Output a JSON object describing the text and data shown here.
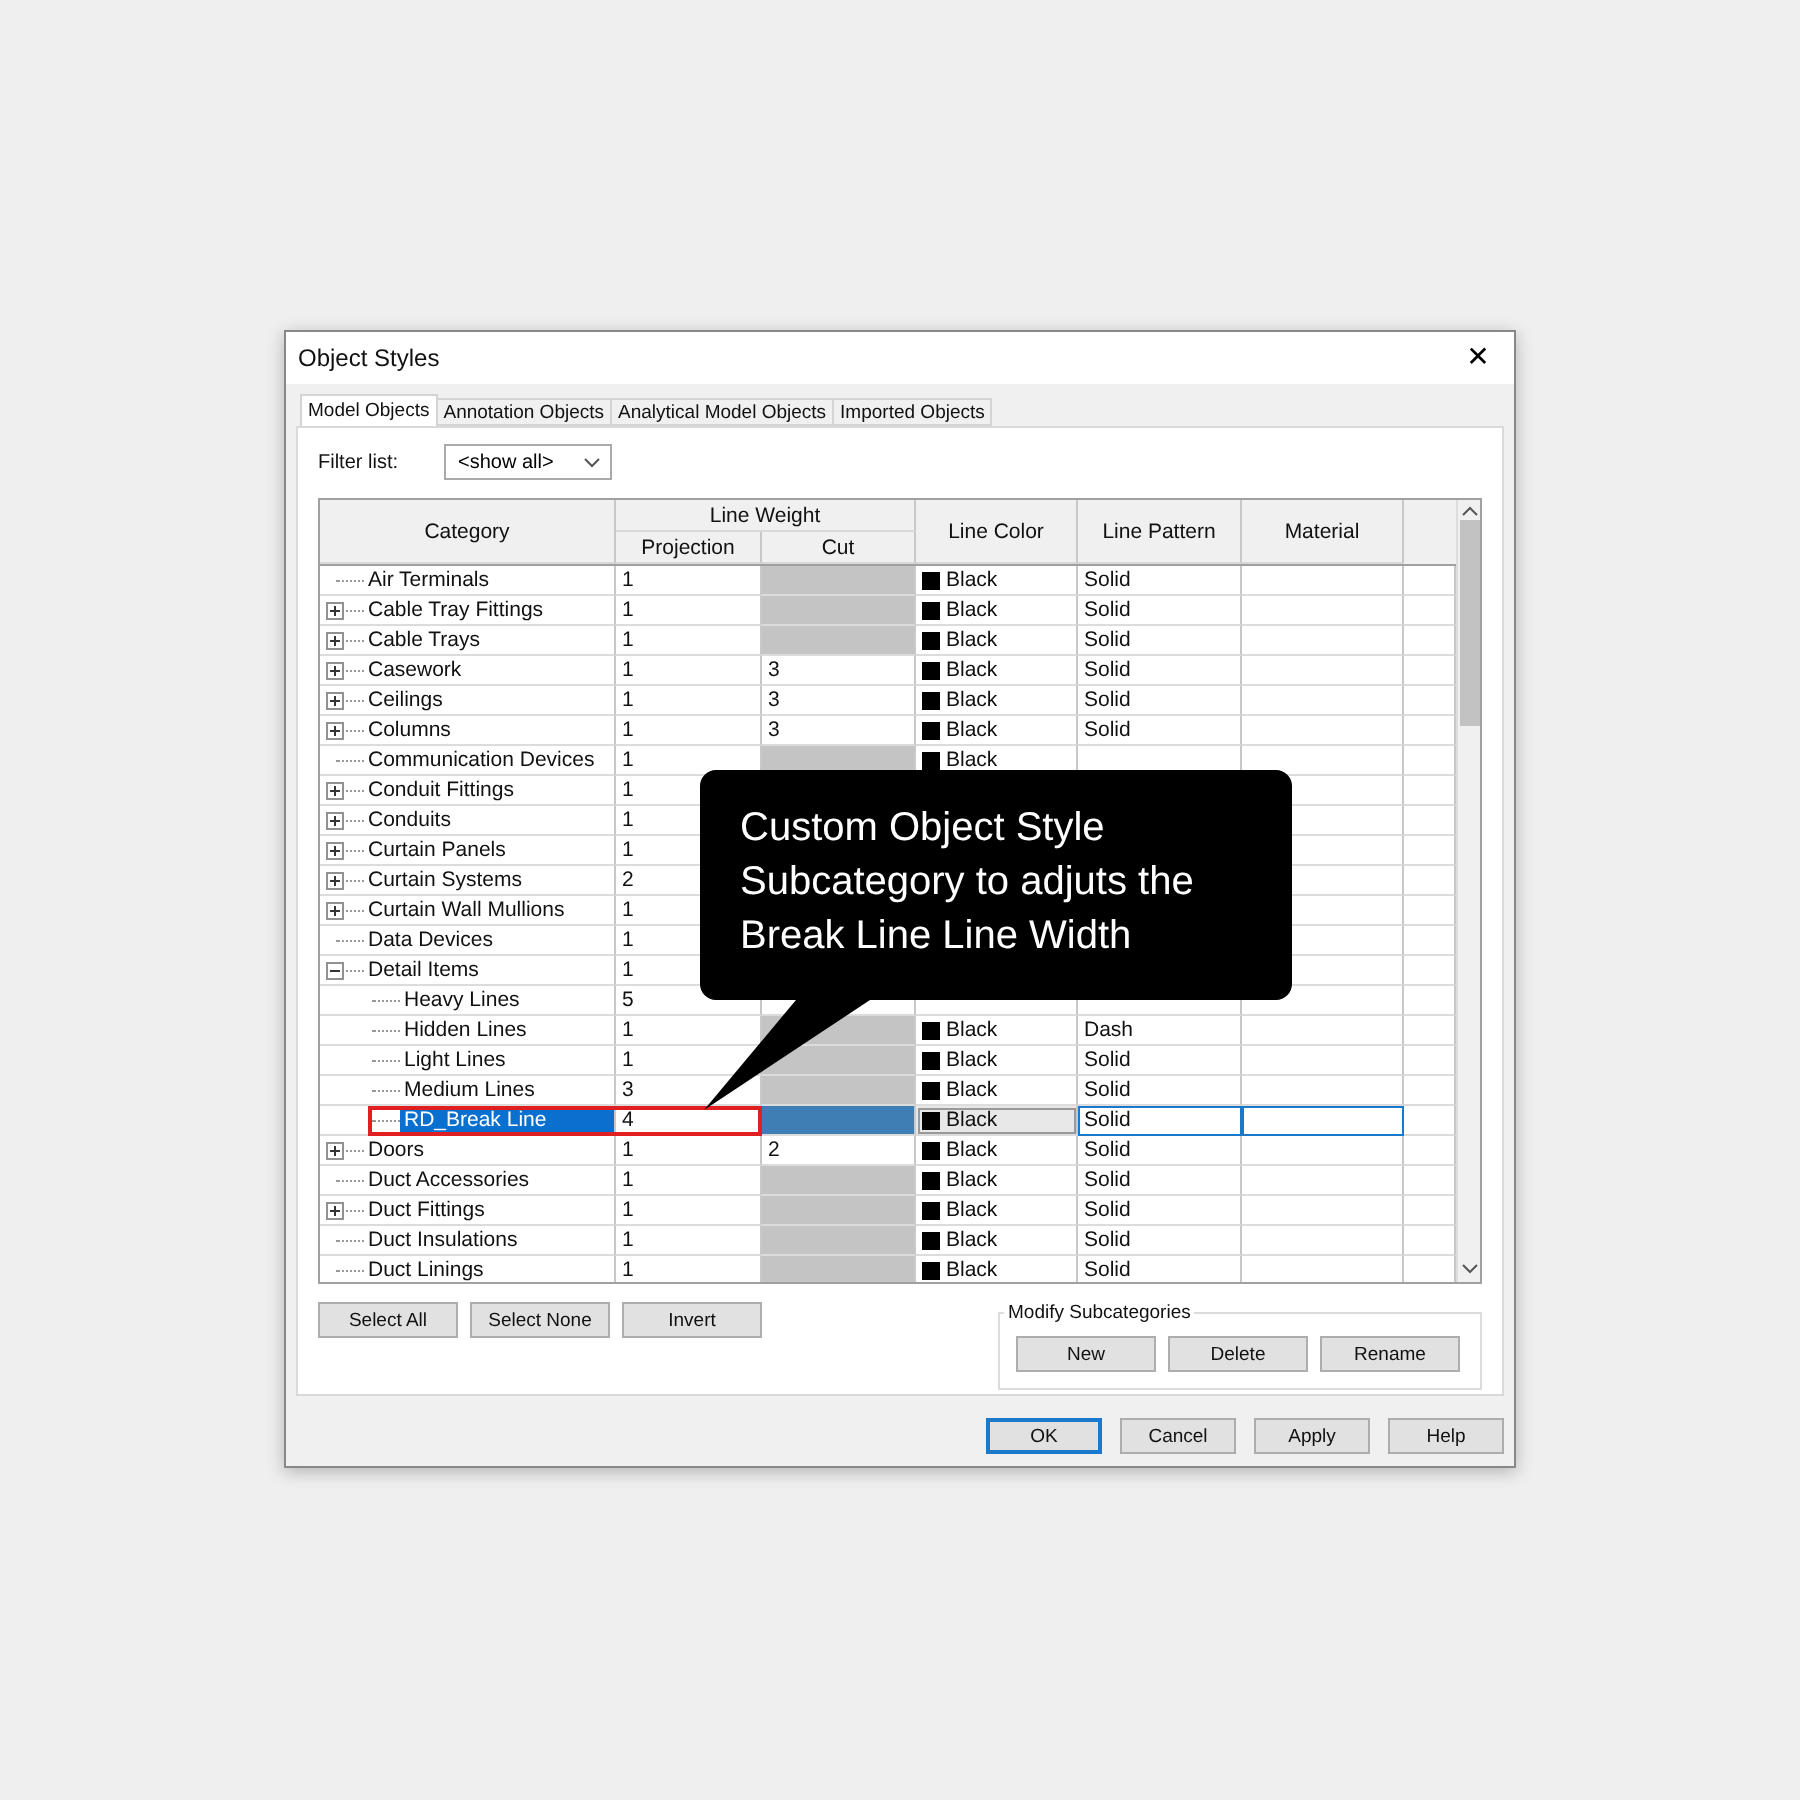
{
  "window": {
    "title": "Object Styles",
    "close": "✕"
  },
  "tabs": [
    {
      "label": "Model Objects",
      "selected": true
    },
    {
      "label": "Annotation Objects",
      "selected": false
    },
    {
      "label": "Analytical Model Objects",
      "selected": false
    },
    {
      "label": "Imported Objects",
      "selected": false
    }
  ],
  "filter": {
    "label": "Filter list:",
    "value": "<show all>"
  },
  "table": {
    "columns": {
      "category": "Category",
      "line_weight": "Line Weight",
      "projection": "Projection",
      "cut": "Cut",
      "line_color": "Line Color",
      "line_pattern": "Line Pattern",
      "material": "Material"
    },
    "rows": [
      {
        "name": "Air Terminals",
        "projection": "1",
        "cut_disabled": true,
        "line_color": "Black",
        "pattern": "Solid",
        "selected": false
      },
      {
        "name": "Cable Tray Fittings",
        "expanded": false,
        "projection": "1",
        "cut_disabled": true,
        "line_color": "Black",
        "pattern": "Solid",
        "selected": false
      },
      {
        "name": "Cable Trays",
        "expanded": false,
        "projection": "1",
        "cut_disabled": true,
        "line_color": "Black",
        "pattern": "Solid",
        "selected": false
      },
      {
        "name": "Casework",
        "expanded": false,
        "projection": "1",
        "cut": "3",
        "cut_disabled": false,
        "line_color": "Black",
        "pattern": "Solid",
        "selected": false
      },
      {
        "name": "Ceilings",
        "expanded": false,
        "projection": "1",
        "cut": "3",
        "cut_disabled": false,
        "line_color": "Black",
        "pattern": "Solid",
        "selected": false
      },
      {
        "name": "Columns",
        "expanded": false,
        "projection": "1",
        "cut": "3",
        "cut_disabled": false,
        "line_color": "Black",
        "pattern": "Solid",
        "selected": false
      },
      {
        "name": "Communication Devices",
        "projection": "1",
        "cut_disabled": true,
        "line_color": "Black",
        "selected": false
      },
      {
        "name": "Conduit Fittings",
        "expanded": false,
        "projection": "1",
        "selected": false
      },
      {
        "name": "Conduits",
        "expanded": false,
        "projection": "1",
        "selected": false
      },
      {
        "name": "Curtain Panels",
        "expanded": false,
        "projection": "1",
        "selected": false
      },
      {
        "name": "Curtain Systems",
        "expanded": false,
        "projection": "2",
        "selected": false
      },
      {
        "name": "Curtain Wall Mullions",
        "expanded": false,
        "projection": "1",
        "selected": false
      },
      {
        "name": "Data Devices",
        "projection": "1",
        "selected": false
      },
      {
        "name": "Detail Items",
        "expanded": true,
        "projection": "1",
        "selected": false,
        "children": [
          {
            "name": "Heavy Lines",
            "projection": "5",
            "selected": false
          },
          {
            "name": "Hidden Lines",
            "projection": "1",
            "cut_disabled": true,
            "line_color": "Black",
            "pattern": "Dash",
            "selected": false
          },
          {
            "name": "Light Lines",
            "projection": "1",
            "cut_disabled": true,
            "line_color": "Black",
            "pattern": "Solid",
            "selected": false
          },
          {
            "name": "Medium Lines",
            "projection": "3",
            "cut_disabled": true,
            "line_color": "Black",
            "pattern": "Solid",
            "selected": false
          },
          {
            "name": "RD_Break Line",
            "projection": "4",
            "cut_disabled": true,
            "line_color": "Black",
            "pattern": "Solid",
            "selected": true
          }
        ]
      },
      {
        "name": "Doors",
        "expanded": false,
        "projection": "1",
        "cut": "2",
        "cut_disabled": false,
        "line_color": "Black",
        "pattern": "Solid",
        "selected": false
      },
      {
        "name": "Duct Accessories",
        "projection": "1",
        "cut_disabled": true,
        "line_color": "Black",
        "pattern": "Solid",
        "selected": false
      },
      {
        "name": "Duct Fittings",
        "expanded": false,
        "projection": "1",
        "cut_disabled": true,
        "line_color": "Black",
        "pattern": "Solid",
        "selected": false
      },
      {
        "name": "Duct Insulations",
        "projection": "1",
        "cut_disabled": true,
        "line_color": "Black",
        "pattern": "Solid",
        "selected": false
      },
      {
        "name": "Duct Linings",
        "projection": "1",
        "cut_disabled": true,
        "line_color": "Black",
        "pattern": "Solid",
        "selected": false
      }
    ]
  },
  "selection_buttons": [
    "Select All",
    "Select None",
    "Invert"
  ],
  "modify_subcategories": {
    "title": "Modify Subcategories",
    "buttons": [
      "New",
      "Delete",
      "Rename"
    ]
  },
  "dialog_buttons": [
    {
      "label": "OK",
      "default": true
    },
    {
      "label": "Cancel",
      "default": false
    },
    {
      "label": "Apply",
      "default": false
    },
    {
      "label": "Help",
      "default": false
    }
  ],
  "callout": {
    "lines": [
      "Custom Object Style",
      "Subcategory to adjuts the",
      "Break Line Line Width"
    ]
  }
}
